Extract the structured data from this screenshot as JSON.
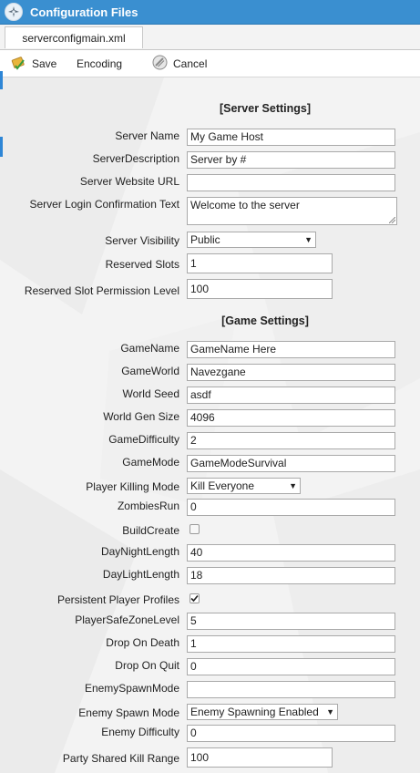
{
  "window": {
    "title": "Configuration Files"
  },
  "tabs": [
    {
      "label": "serverconfigmain.xml"
    }
  ],
  "toolbar": {
    "save_label": "Save",
    "encoding_label": "Encoding",
    "cancel_label": "Cancel"
  },
  "server_section": {
    "heading": "[Server Settings]",
    "server_name": {
      "label": "Server Name",
      "value": "My Game Host"
    },
    "server_description": {
      "label": "ServerDescription",
      "value": "Server by #"
    },
    "server_website_url": {
      "label": "Server Website URL",
      "value": ""
    },
    "server_login_confirmation_text": {
      "label": "Server Login Confirmation Text",
      "value": "Welcome to the server"
    },
    "server_visibility": {
      "label": "Server Visibility",
      "value": "Public"
    },
    "reserved_slots": {
      "label": "Reserved Slots",
      "value": "1"
    },
    "reserved_slot_permission_level": {
      "label": "Reserved Slot Permission Level",
      "value": "100"
    }
  },
  "game_section": {
    "heading": "[Game Settings]",
    "game_name": {
      "label": "GameName",
      "value": "GameName Here"
    },
    "game_world": {
      "label": "GameWorld",
      "value": "Navezgane"
    },
    "world_seed": {
      "label": "World Seed",
      "value": "asdf"
    },
    "world_gen_size": {
      "label": "World Gen Size",
      "value": "4096"
    },
    "game_difficulty": {
      "label": "GameDifficulty",
      "value": "2"
    },
    "game_mode": {
      "label": "GameMode",
      "value": "GameModeSurvival"
    },
    "player_killing_mode": {
      "label": "Player Killing Mode",
      "value": "Kill Everyone"
    },
    "zombies_run": {
      "label": "ZombiesRun",
      "value": "0"
    },
    "build_create": {
      "label": "BuildCreate",
      "checked": false
    },
    "day_night_length": {
      "label": "DayNightLength",
      "value": "40"
    },
    "day_light_length": {
      "label": "DayLightLength",
      "value": "18"
    },
    "persistent_player_profiles": {
      "label": "Persistent Player Profiles",
      "checked": true
    },
    "player_safe_zone_level": {
      "label": "PlayerSafeZoneLevel",
      "value": "5"
    },
    "drop_on_death": {
      "label": "Drop On Death",
      "value": "1"
    },
    "drop_on_quit": {
      "label": "Drop On Quit",
      "value": "0"
    },
    "enemy_spawn_mode_text": {
      "label": "EnemySpawnMode",
      "value": ""
    },
    "enemy_spawn_mode_select": {
      "label": "Enemy Spawn Mode",
      "value": "Enemy Spawning Enabled"
    },
    "enemy_difficulty": {
      "label": "Enemy Difficulty",
      "value": "0"
    },
    "party_shared_kill_range": {
      "label": "Party Shared Kill Range",
      "value": "100"
    }
  },
  "colors": {
    "titlebar": "#3a8fd0",
    "accent": "#2e86d6",
    "background": "#f3f3f3"
  }
}
